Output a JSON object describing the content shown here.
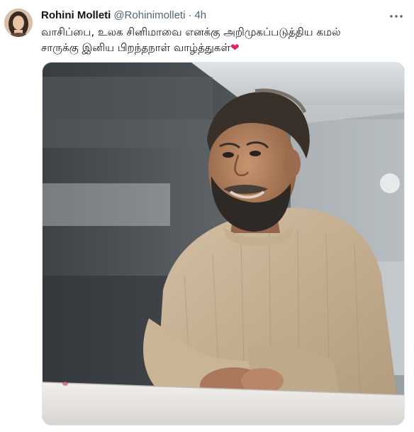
{
  "tweet": {
    "author": {
      "display_name": "Rohini Molleti",
      "handle": "@Rohinimolleti",
      "separator": "·",
      "timestamp": "4h"
    },
    "text_lines": [
      "வாசிப்பை, உலக சினிமாவை எனக்கு அறிமுகப்படுத்திய கமல்",
      "சாருக்கு இனிய பிறந்தநாள் வாழ்த்துகள்"
    ],
    "text_emoji": "❤",
    "more_icon": "more-horizontal-icon",
    "media": {
      "type": "photo"
    }
  },
  "colors": {
    "text_primary": "#0f1419",
    "text_secondary": "#536471",
    "heart": "#e0245e",
    "sweater": "#c8b396"
  }
}
